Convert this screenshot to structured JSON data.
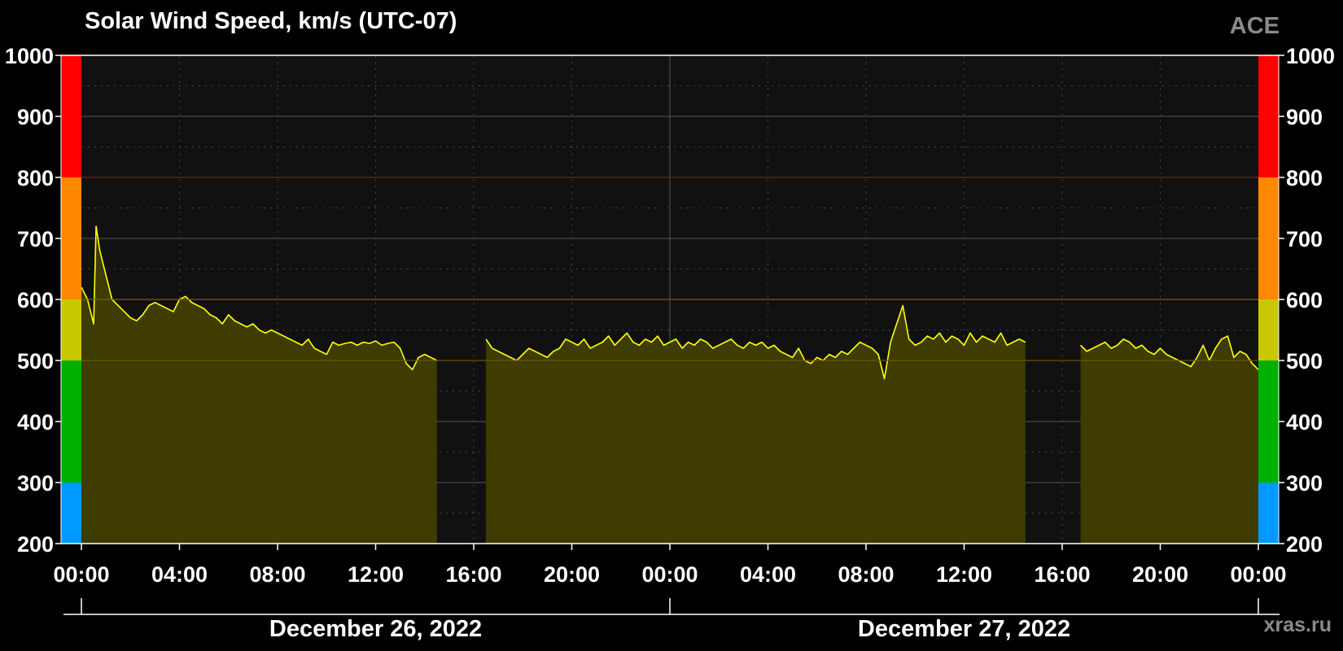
{
  "header": {
    "title": "Solar Wind Speed, km/s (UTC-07)",
    "source_label": "ACE",
    "credit": "xras.ru"
  },
  "colors": {
    "background": "#000000",
    "plot_background": "#111111",
    "grid_major": "#555555",
    "grid_minor": "#444444",
    "fill": "#3e3c00",
    "line": "#ffff00",
    "threshold_500": "#6a5400",
    "threshold_600": "#7a5c00",
    "threshold_800": "#7a1f1f"
  },
  "chart_data": {
    "type": "area",
    "title": "Solar Wind Speed, km/s (UTC-07)",
    "xlabel": "",
    "ylabel": "",
    "ylim": [
      200,
      1000
    ],
    "yticks": [
      200,
      300,
      400,
      500,
      600,
      700,
      800,
      900,
      1000
    ],
    "xlim_hours": [
      0,
      48
    ],
    "xtick_labels": [
      "00:00",
      "04:00",
      "08:00",
      "12:00",
      "16:00",
      "20:00",
      "00:00",
      "04:00",
      "08:00",
      "12:00",
      "16:00",
      "20:00",
      "00:00"
    ],
    "date_labels": [
      "December 26, 2022",
      "December 27, 2022"
    ],
    "grid": true,
    "legend": "none",
    "threshold_lines": [
      500,
      600,
      800
    ],
    "scale_bands": [
      {
        "from": 200,
        "to": 300,
        "color": "#0099ff"
      },
      {
        "from": 300,
        "to": 500,
        "color": "#00b000"
      },
      {
        "from": 500,
        "to": 600,
        "color": "#c8c800"
      },
      {
        "from": 600,
        "to": 800,
        "color": "#ff8800"
      },
      {
        "from": 800,
        "to": 1000,
        "color": "#ff0000"
      }
    ],
    "series": [
      {
        "x": [
          0.0,
          0.25,
          0.5,
          0.6,
          0.75,
          1.0,
          1.25,
          1.5,
          1.75,
          2.0,
          2.25,
          2.5,
          2.75,
          3.0,
          3.25,
          3.5,
          3.75,
          4.0,
          4.25,
          4.5,
          4.75,
          5.0,
          5.25,
          5.5,
          5.75,
          6.0,
          6.25,
          6.5,
          6.75,
          7.0,
          7.25,
          7.5,
          7.75,
          8.0,
          8.25,
          8.5,
          8.75,
          9.0,
          9.25,
          9.5,
          9.75,
          10.0,
          10.25,
          10.5,
          10.75,
          11.0,
          11.25,
          11.5,
          11.75,
          12.0,
          12.25,
          12.5,
          12.75,
          13.0,
          13.25,
          13.5,
          13.75,
          14.0,
          14.25,
          14.5
        ],
        "y": [
          620,
          600,
          560,
          720,
          680,
          640,
          600,
          590,
          580,
          570,
          565,
          575,
          590,
          595,
          590,
          585,
          580,
          600,
          605,
          595,
          590,
          585,
          575,
          570,
          560,
          575,
          565,
          560,
          555,
          560,
          550,
          545,
          550,
          545,
          540,
          535,
          530,
          525,
          535,
          520,
          515,
          510,
          530,
          525,
          528,
          530,
          525,
          530,
          528,
          532,
          525,
          528,
          530,
          520,
          495,
          485,
          505,
          510,
          505,
          500
        ]
      },
      {
        "x": [
          16.5,
          16.75,
          17.0,
          17.25,
          17.5,
          17.75,
          18.0,
          18.25,
          18.5,
          18.75,
          19.0,
          19.25,
          19.5,
          19.75,
          20.0,
          20.25,
          20.5,
          20.75,
          21.0,
          21.25,
          21.5,
          21.75,
          22.0,
          22.25,
          22.5,
          22.75,
          23.0,
          23.25,
          23.5,
          23.75,
          24.0,
          24.25,
          24.5,
          24.75,
          25.0,
          25.25,
          25.5,
          25.75,
          26.0,
          26.25,
          26.5,
          26.75,
          27.0,
          27.25,
          27.5,
          27.75,
          28.0,
          28.25,
          28.5,
          28.75,
          29.0,
          29.25,
          29.5,
          29.75,
          30.0,
          30.25,
          30.5,
          30.75,
          31.0,
          31.25,
          31.5,
          31.75,
          32.0,
          32.25,
          32.5,
          32.75,
          33.0,
          33.25,
          33.5,
          33.75,
          34.0,
          34.25,
          34.5,
          34.75,
          35.0,
          35.25,
          35.5,
          35.75,
          36.0,
          36.25,
          36.5,
          36.75,
          37.0,
          37.25,
          37.5,
          37.75,
          38.0,
          38.25,
          38.5
        ],
        "y": [
          535,
          520,
          515,
          510,
          505,
          500,
          510,
          520,
          515,
          510,
          505,
          515,
          520,
          535,
          530,
          525,
          535,
          520,
          525,
          530,
          540,
          525,
          535,
          545,
          530,
          525,
          535,
          530,
          540,
          525,
          530,
          535,
          520,
          530,
          525,
          535,
          530,
          520,
          525,
          530,
          535,
          525,
          520,
          530,
          525,
          530,
          520,
          525,
          515,
          510,
          505,
          520,
          500,
          495,
          505,
          500,
          510,
          505,
          515,
          510,
          520,
          530,
          525,
          520,
          510,
          470,
          530,
          560,
          590,
          535,
          525,
          530,
          540,
          535,
          545,
          530,
          540,
          535,
          525,
          545,
          530,
          540,
          535,
          530,
          545,
          525,
          530,
          535,
          530
        ]
      },
      {
        "x": [
          40.75,
          41.0,
          41.25,
          41.5,
          41.75,
          42.0,
          42.25,
          42.5,
          42.75,
          43.0,
          43.25,
          43.5,
          43.75,
          44.0,
          44.25,
          44.5,
          44.75,
          45.0,
          45.25,
          45.5,
          45.75,
          46.0,
          46.25,
          46.5,
          46.75,
          47.0,
          47.25,
          47.5,
          47.75,
          48.0
        ],
        "y": [
          525,
          515,
          520,
          525,
          530,
          520,
          525,
          535,
          530,
          520,
          525,
          515,
          510,
          520,
          510,
          505,
          500,
          495,
          490,
          505,
          525,
          500,
          520,
          535,
          540,
          505,
          515,
          510,
          495,
          485
        ]
      }
    ]
  }
}
